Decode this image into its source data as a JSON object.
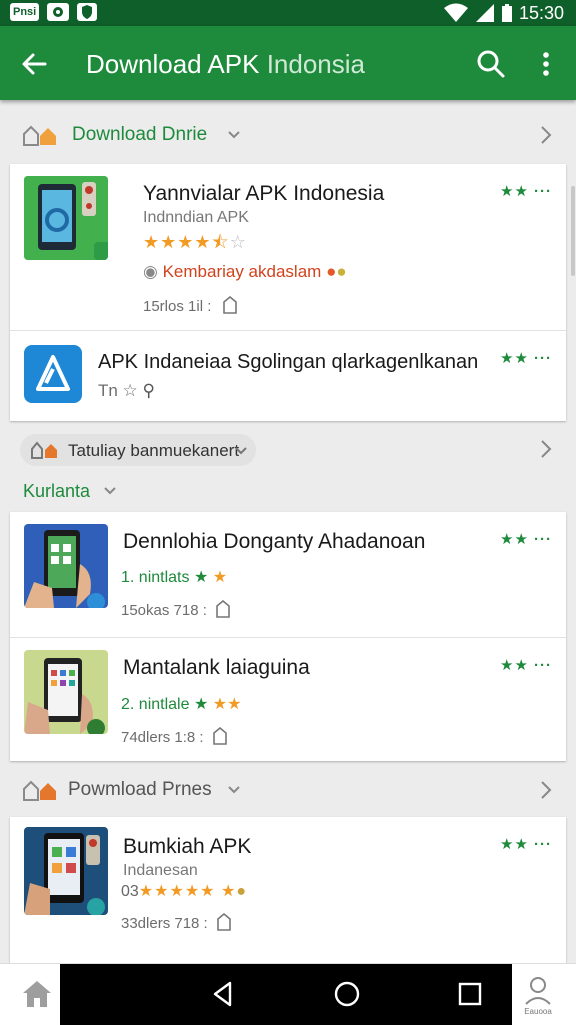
{
  "status_bar": {
    "chip1": "Pnsi",
    "time": "15:30"
  },
  "app_bar": {
    "title": "Download APK",
    "title_suffix": "Indonsia"
  },
  "sections": [
    {
      "label": "Download Dnrie"
    },
    {
      "label": "Tatuliay banmuekanert",
      "sub_label": "Kurlanta"
    },
    {
      "label": "Powmload Prnes"
    }
  ],
  "rows": [
    {
      "title": "Yannvialar APK Indonesia",
      "subtitle": "Indnndian APK",
      "rating": 4.5,
      "promo": "Kembariay akdaslam",
      "meta": "15rlos 1il :",
      "mini": "★★ ···"
    },
    {
      "title": "APK Indaneiaa Sgolingan qlarkagenlkanan",
      "meta": "Tn ☆",
      "mini": "★★ ···"
    },
    {
      "title": "Dennlohia Donganty Ahadanoan",
      "line2": "1. nintlats",
      "meta": "15okas 718 :",
      "mini": "★★ ···"
    },
    {
      "title": "Mantalank laiaguina",
      "line2": "2. nintlale",
      "meta": "74dlers 1:8 :",
      "mini": "★★ ···"
    },
    {
      "title": "Bumkiah APK",
      "subtitle": "Indanesan",
      "line2": "03",
      "meta": "33dlers 718 :",
      "mini": "★★ ···"
    }
  ],
  "bottom_nav": {
    "profile_label": "Eauooa"
  },
  "colors": {
    "status": "#0f5f2a",
    "app_bar": "#1e8a3c",
    "accent_green": "#1e8a3c",
    "star": "#f19b25"
  }
}
